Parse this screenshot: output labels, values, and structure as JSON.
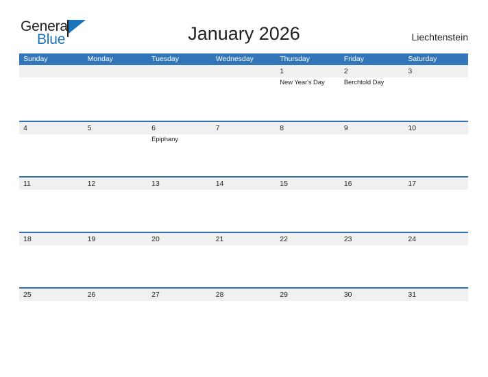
{
  "brand": {
    "name_part1": "General",
    "name_part2": "Blue",
    "flag_icon": "blue-flag-triangle",
    "colors": {
      "text": "#231f20",
      "blue": "#1b75bc"
    }
  },
  "header": {
    "title": "January 2026",
    "country": "Liechtenstein"
  },
  "calendar": {
    "colors": {
      "header_blue": "#3275b8",
      "row_divider_blue": "#2e72b4",
      "band_gray": "#f0f0f0"
    },
    "weekdays": [
      "Sunday",
      "Monday",
      "Tuesday",
      "Wednesday",
      "Thursday",
      "Friday",
      "Saturday"
    ],
    "weeks": [
      [
        {
          "day": "",
          "events": []
        },
        {
          "day": "",
          "events": []
        },
        {
          "day": "",
          "events": []
        },
        {
          "day": "",
          "events": []
        },
        {
          "day": "1",
          "events": [
            "New Year's Day"
          ]
        },
        {
          "day": "2",
          "events": [
            "Berchtold Day"
          ]
        },
        {
          "day": "3",
          "events": []
        }
      ],
      [
        {
          "day": "4",
          "events": []
        },
        {
          "day": "5",
          "events": []
        },
        {
          "day": "6",
          "events": [
            "Epiphany"
          ]
        },
        {
          "day": "7",
          "events": []
        },
        {
          "day": "8",
          "events": []
        },
        {
          "day": "9",
          "events": []
        },
        {
          "day": "10",
          "events": []
        }
      ],
      [
        {
          "day": "11",
          "events": []
        },
        {
          "day": "12",
          "events": []
        },
        {
          "day": "13",
          "events": []
        },
        {
          "day": "14",
          "events": []
        },
        {
          "day": "15",
          "events": []
        },
        {
          "day": "16",
          "events": []
        },
        {
          "day": "17",
          "events": []
        }
      ],
      [
        {
          "day": "18",
          "events": []
        },
        {
          "day": "19",
          "events": []
        },
        {
          "day": "20",
          "events": []
        },
        {
          "day": "21",
          "events": []
        },
        {
          "day": "22",
          "events": []
        },
        {
          "day": "23",
          "events": []
        },
        {
          "day": "24",
          "events": []
        }
      ],
      [
        {
          "day": "25",
          "events": []
        },
        {
          "day": "26",
          "events": []
        },
        {
          "day": "27",
          "events": []
        },
        {
          "day": "28",
          "events": []
        },
        {
          "day": "29",
          "events": []
        },
        {
          "day": "30",
          "events": []
        },
        {
          "day": "31",
          "events": []
        }
      ]
    ]
  }
}
